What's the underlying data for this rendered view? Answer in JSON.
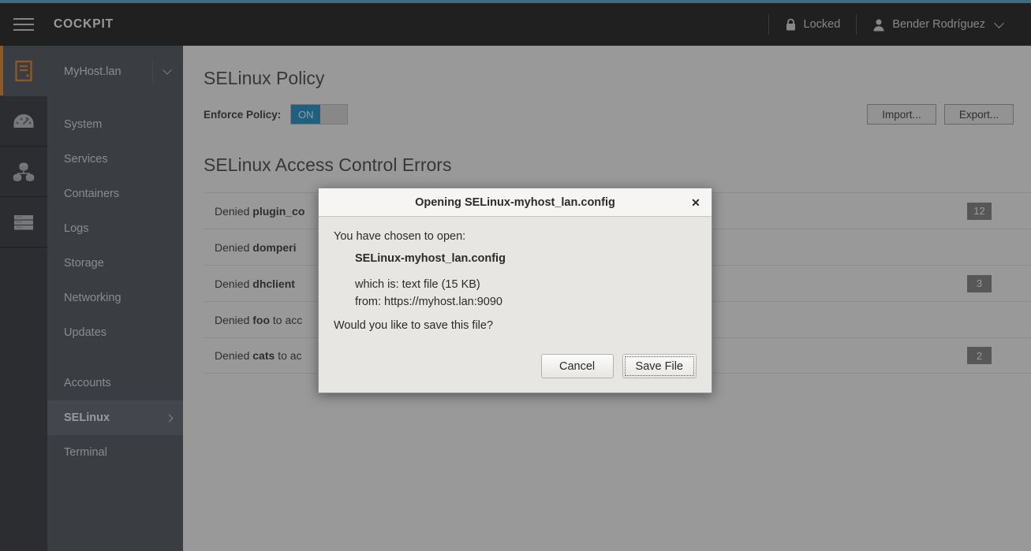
{
  "theme": {
    "accent_orange": "#ec7a08",
    "accent_blue": "#39a5dc",
    "toggle_blue": "#0088ce",
    "header_black": "#030303",
    "sidebar_gray": "#393f4a",
    "sidebar_active": "#4d5360",
    "badge_gray": "#767676"
  },
  "header": {
    "brand": "COCKPIT",
    "hamburger_icon": "hamburger-menu-icon",
    "locked_label": "Locked",
    "locked_icon": "lock-icon",
    "user_name": "Bender Rodríguez",
    "user_icon": "user-avatar-icon",
    "user_caret_icon": "chevron-down-icon"
  },
  "rail": {
    "items": [
      {
        "icon": "server-icon",
        "name": "rail-item-host",
        "active": true
      },
      {
        "icon": "dashboard-gauge-icon",
        "name": "rail-item-dashboard",
        "active": false
      },
      {
        "icon": "cluster-nodes-icon",
        "name": "rail-item-containers",
        "active": false
      },
      {
        "icon": "server-rack-icon",
        "name": "rail-item-machines",
        "active": false
      }
    ]
  },
  "sidebar": {
    "host": "MyHost.lan",
    "host_caret_icon": "chevron-down-icon",
    "items": [
      {
        "label": "System",
        "active": false,
        "gap_above": false,
        "chevron": false
      },
      {
        "label": "Services",
        "active": false,
        "gap_above": false,
        "chevron": false
      },
      {
        "label": "Containers",
        "active": false,
        "gap_above": false,
        "chevron": false
      },
      {
        "label": "Logs",
        "active": false,
        "gap_above": false,
        "chevron": false
      },
      {
        "label": "Storage",
        "active": false,
        "gap_above": false,
        "chevron": false
      },
      {
        "label": "Networking",
        "active": false,
        "gap_above": false,
        "chevron": false
      },
      {
        "label": "Updates",
        "active": false,
        "gap_above": false,
        "chevron": false
      },
      {
        "label": "Accounts",
        "active": false,
        "gap_above": true,
        "chevron": false
      },
      {
        "label": "SELinux",
        "active": true,
        "gap_above": false,
        "chevron": true
      },
      {
        "label": "Terminal",
        "active": false,
        "gap_above": false,
        "chevron": false
      }
    ]
  },
  "main": {
    "page_title": "SELinux Policy",
    "enforce_label": "Enforce Policy:",
    "toggle_state": "ON",
    "import_label": "Import...",
    "export_label": "Export...",
    "section_title": "SELinux Access Control Errors",
    "errors": [
      {
        "prefix": "Denied ",
        "subject": "plugin_co",
        "suffix": "",
        "count": "12"
      },
      {
        "prefix": "Denied ",
        "subject": "domperi",
        "suffix": "",
        "count": ""
      },
      {
        "prefix": "Denied ",
        "subject": "dhclient",
        "suffix": "",
        "count": "3"
      },
      {
        "prefix": "Denied ",
        "subject": "foo",
        "suffix": " to acc",
        "count": ""
      },
      {
        "prefix": "Denied ",
        "subject": "cats",
        "suffix": " to ac",
        "count": "2"
      }
    ]
  },
  "dialog": {
    "title": "Opening SELinux-myhost_lan.config",
    "close_icon": "close-x-icon",
    "intro": "You have chosen to open:",
    "filename": "SELinux-myhost_lan.config",
    "which_is": "which is: text file (15 KB)",
    "from": "from: https://myhost.lan:9090",
    "question": "Would you like to save this file?",
    "cancel_label": "Cancel",
    "save_label": "Save File"
  }
}
